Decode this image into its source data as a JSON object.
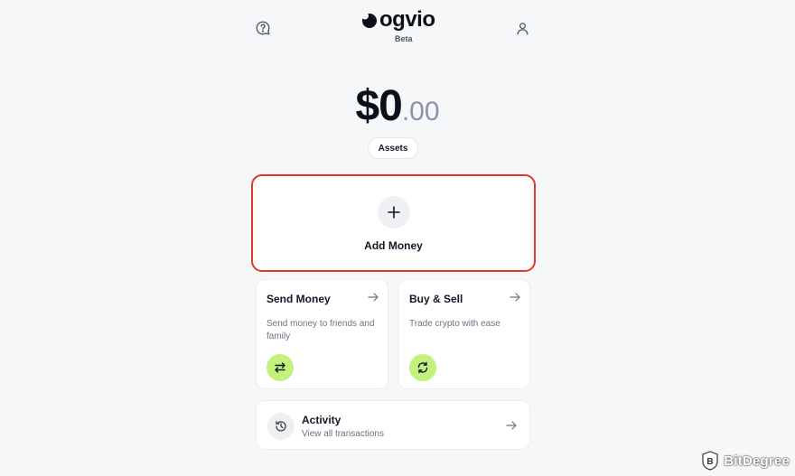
{
  "header": {
    "help_icon": "help-chat-icon",
    "brand": "ogvio",
    "badge": "Beta",
    "profile_icon": "user-icon"
  },
  "balance": {
    "whole": "$0",
    "cents": ".00"
  },
  "assets_button": "Assets",
  "add_money": {
    "label": "Add Money",
    "highlight_color": "#e3372a"
  },
  "send_money": {
    "title": "Send Money",
    "description": "Send money to friends and family",
    "icon": "swap-arrows-icon"
  },
  "buy_sell": {
    "title": "Buy & Sell",
    "description": "Trade crypto with ease",
    "icon": "refresh-icon"
  },
  "activity": {
    "title": "Activity",
    "subtitle": "View all transactions",
    "icon": "history-icon"
  },
  "watermark": {
    "text": "BitDegree"
  },
  "colors": {
    "accent_green": "#c4f07c",
    "background": "#f6f7f9"
  }
}
